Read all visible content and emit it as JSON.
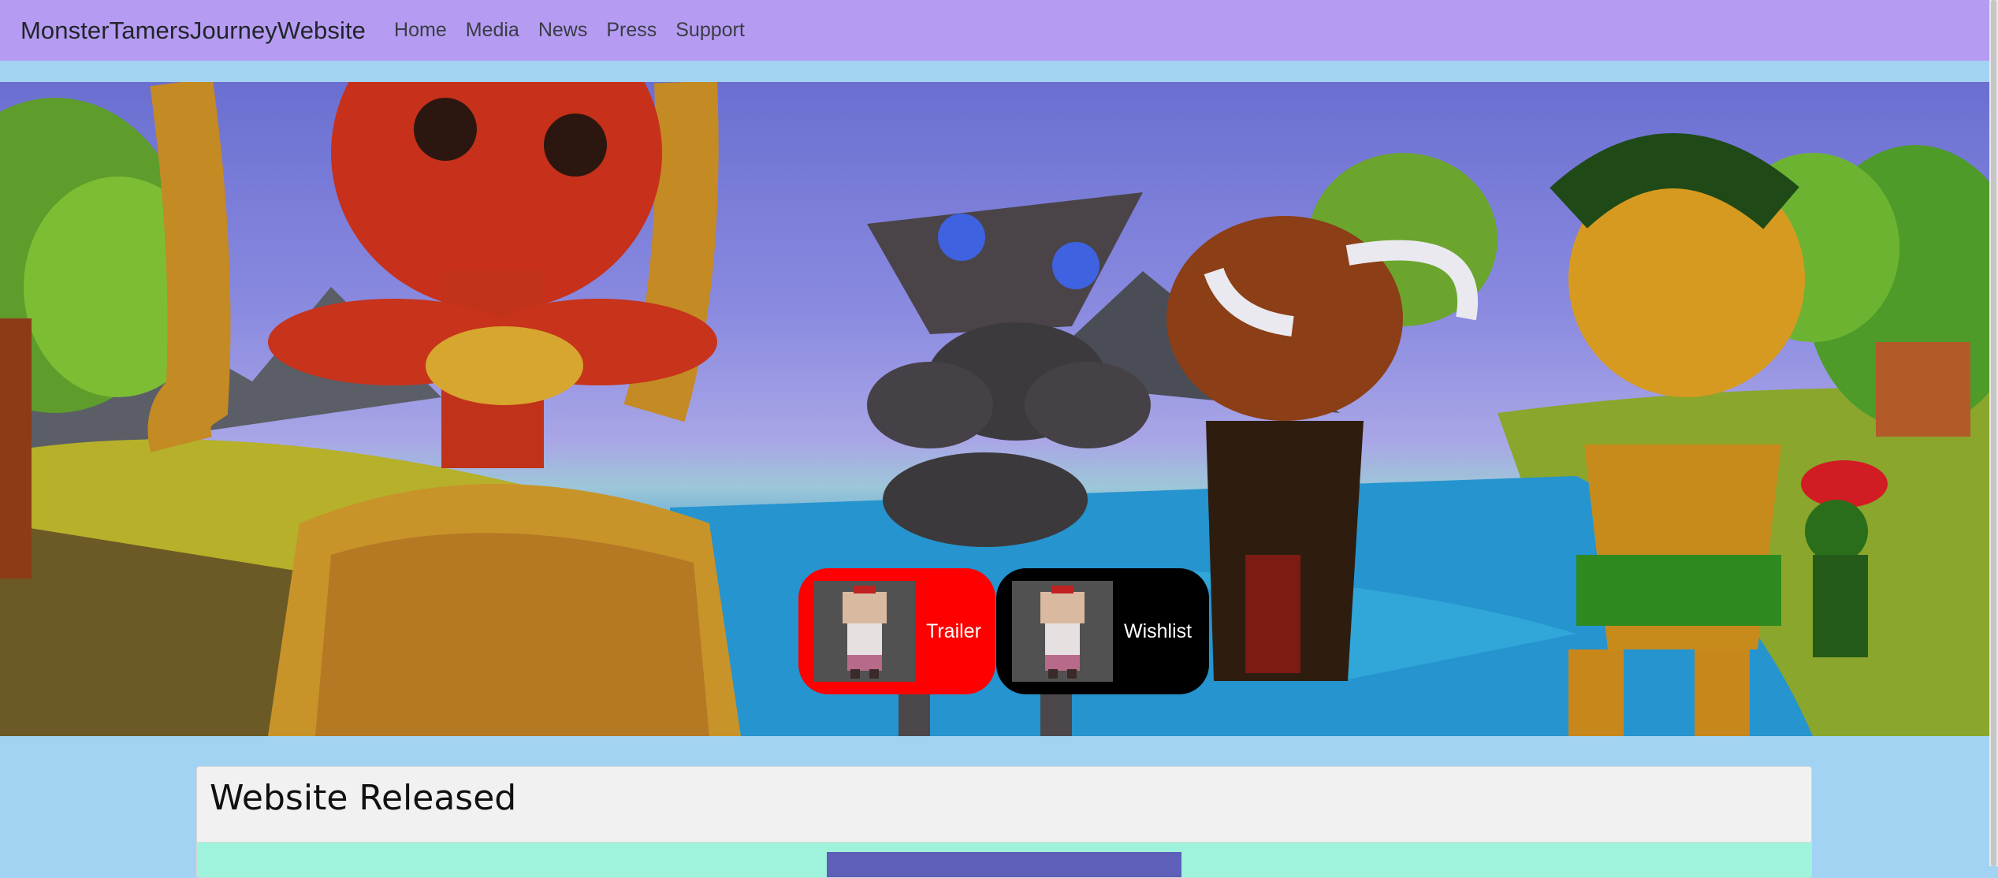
{
  "navbar": {
    "brand": "MonsterTamersJourneyWebsite",
    "links": [
      "Home",
      "Media",
      "News",
      "Press",
      "Support"
    ]
  },
  "hero": {
    "buttons": {
      "trailer": "Trailer",
      "wishlist": "Wishlist"
    }
  },
  "article": {
    "title": "Website Released"
  },
  "colors": {
    "navbar": "#b59cf2",
    "page_background": "#a3d3f3",
    "trailer_button": "#ff0000",
    "wishlist_button": "#000000",
    "card_body": "#9ff2dc"
  }
}
